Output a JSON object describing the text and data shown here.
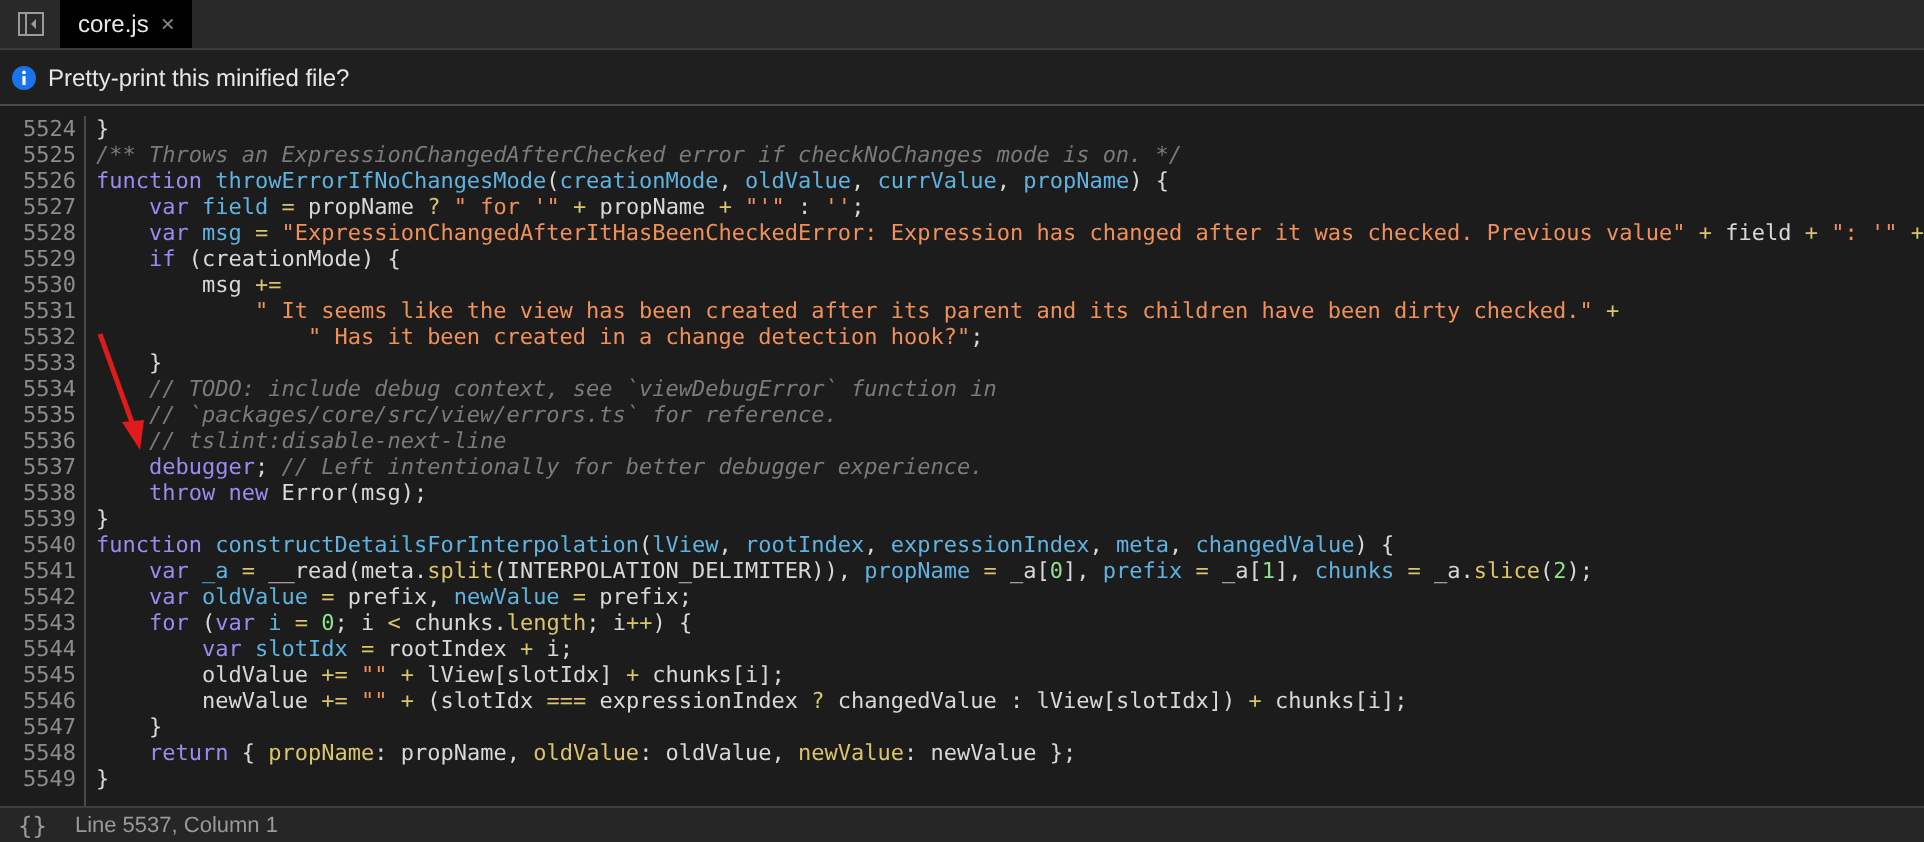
{
  "tab_bar": {
    "tabs": [
      {
        "label": "core.js",
        "close": "×",
        "selected": true
      }
    ]
  },
  "info_bar": {
    "message": "Pretty-print this minified file?"
  },
  "editor": {
    "lines": [
      {
        "number": "5524",
        "tokens": [
          {
            "kind": "plain",
            "text": "}"
          }
        ]
      },
      {
        "number": "5525",
        "tokens": [
          {
            "kind": "comment",
            "text": "/** Throws an ExpressionChangedAfterChecked error if checkNoChanges mode is on. */"
          }
        ]
      },
      {
        "number": "5526",
        "tokens": [
          {
            "kind": "keyword",
            "text": "function"
          },
          {
            "kind": "def",
            "text": " throwErrorIfNoChangesMode"
          },
          {
            "kind": "plain",
            "text": "("
          },
          {
            "kind": "def",
            "text": "creationMode"
          },
          {
            "kind": "plain",
            "text": ", "
          },
          {
            "kind": "def",
            "text": "oldValue"
          },
          {
            "kind": "plain",
            "text": ", "
          },
          {
            "kind": "def",
            "text": "currValue"
          },
          {
            "kind": "plain",
            "text": ", "
          },
          {
            "kind": "def",
            "text": "propName"
          },
          {
            "kind": "plain",
            "text": ") {"
          }
        ]
      },
      {
        "number": "5527",
        "tokens": [
          {
            "kind": "keyword",
            "text": "    var"
          },
          {
            "kind": "def",
            "text": " field"
          },
          {
            "kind": "op",
            "text": " ="
          },
          {
            "kind": "plain",
            "text": " propName "
          },
          {
            "kind": "op",
            "text": "?"
          },
          {
            "kind": "string",
            "text": " \" for '\""
          },
          {
            "kind": "op",
            "text": " +"
          },
          {
            "kind": "plain",
            "text": " propName "
          },
          {
            "kind": "op",
            "text": "+"
          },
          {
            "kind": "string",
            "text": " \"'\""
          },
          {
            "kind": "plain",
            "text": " : "
          },
          {
            "kind": "string",
            "text": "''"
          },
          {
            "kind": "plain",
            "text": ";"
          }
        ]
      },
      {
        "number": "5528",
        "tokens": [
          {
            "kind": "keyword",
            "text": "    var"
          },
          {
            "kind": "def",
            "text": " msg"
          },
          {
            "kind": "op",
            "text": " ="
          },
          {
            "kind": "string",
            "text": " \"ExpressionChangedAfterItHasBeenCheckedError: Expression has changed after it was checked. Previous value\""
          },
          {
            "kind": "op",
            "text": " +"
          },
          {
            "kind": "plain",
            "text": " field "
          },
          {
            "kind": "op",
            "text": "+"
          },
          {
            "kind": "string",
            "text": " \": '\""
          },
          {
            "kind": "op",
            "text": " +"
          }
        ]
      },
      {
        "number": "5529",
        "tokens": [
          {
            "kind": "keyword",
            "text": "    if"
          },
          {
            "kind": "plain",
            "text": " (creationMode) {"
          }
        ]
      },
      {
        "number": "5530",
        "tokens": [
          {
            "kind": "plain",
            "text": "        msg "
          },
          {
            "kind": "op",
            "text": "+="
          }
        ]
      },
      {
        "number": "5531",
        "tokens": [
          {
            "kind": "string",
            "text": "            \" It seems like the view has been created after its parent and its children have been dirty checked.\""
          },
          {
            "kind": "op",
            "text": " +"
          }
        ]
      },
      {
        "number": "5532",
        "tokens": [
          {
            "kind": "string",
            "text": "                \" Has it been created in a change detection hook?\""
          },
          {
            "kind": "plain",
            "text": ";"
          }
        ]
      },
      {
        "number": "5533",
        "tokens": [
          {
            "kind": "plain",
            "text": "    }"
          }
        ]
      },
      {
        "number": "5534",
        "tokens": [
          {
            "kind": "comment",
            "text": "    // TODO: include debug context, see `viewDebugError` function in"
          }
        ]
      },
      {
        "number": "5535",
        "tokens": [
          {
            "kind": "comment",
            "text": "    // `packages/core/src/view/errors.ts` for reference."
          }
        ]
      },
      {
        "number": "5536",
        "tokens": [
          {
            "kind": "comment",
            "text": "    // tslint:disable-next-line"
          }
        ]
      },
      {
        "number": "5537",
        "tokens": [
          {
            "kind": "keyword",
            "text": "    debugger"
          },
          {
            "kind": "plain",
            "text": ";"
          },
          {
            "kind": "comment",
            "text": " // Left intentionally for better debugger experience."
          }
        ]
      },
      {
        "number": "5538",
        "tokens": [
          {
            "kind": "keyword",
            "text": "    throw new"
          },
          {
            "kind": "plain",
            "text": " Error(msg);"
          }
        ]
      },
      {
        "number": "5539",
        "tokens": [
          {
            "kind": "plain",
            "text": "}"
          }
        ]
      },
      {
        "number": "5540",
        "tokens": [
          {
            "kind": "keyword",
            "text": "function"
          },
          {
            "kind": "def",
            "text": " constructDetailsForInterpolation"
          },
          {
            "kind": "plain",
            "text": "("
          },
          {
            "kind": "def",
            "text": "lView"
          },
          {
            "kind": "plain",
            "text": ", "
          },
          {
            "kind": "def",
            "text": "rootIndex"
          },
          {
            "kind": "plain",
            "text": ", "
          },
          {
            "kind": "def",
            "text": "expressionIndex"
          },
          {
            "kind": "plain",
            "text": ", "
          },
          {
            "kind": "def",
            "text": "meta"
          },
          {
            "kind": "plain",
            "text": ", "
          },
          {
            "kind": "def",
            "text": "changedValue"
          },
          {
            "kind": "plain",
            "text": ") {"
          }
        ]
      },
      {
        "number": "5541",
        "tokens": [
          {
            "kind": "keyword",
            "text": "    var"
          },
          {
            "kind": "def",
            "text": " _a"
          },
          {
            "kind": "op",
            "text": " ="
          },
          {
            "kind": "plain",
            "text": " __read(meta."
          },
          {
            "kind": "prop",
            "text": "split"
          },
          {
            "kind": "plain",
            "text": "(INTERPOLATION_DELIMITER)), "
          },
          {
            "kind": "def",
            "text": "propName"
          },
          {
            "kind": "op",
            "text": " ="
          },
          {
            "kind": "plain",
            "text": " _a["
          },
          {
            "kind": "number",
            "text": "0"
          },
          {
            "kind": "plain",
            "text": "], "
          },
          {
            "kind": "def",
            "text": "prefix"
          },
          {
            "kind": "op",
            "text": " ="
          },
          {
            "kind": "plain",
            "text": " _a["
          },
          {
            "kind": "number",
            "text": "1"
          },
          {
            "kind": "plain",
            "text": "], "
          },
          {
            "kind": "def",
            "text": "chunks"
          },
          {
            "kind": "op",
            "text": " ="
          },
          {
            "kind": "plain",
            "text": " _a."
          },
          {
            "kind": "prop",
            "text": "slice"
          },
          {
            "kind": "plain",
            "text": "("
          },
          {
            "kind": "number",
            "text": "2"
          },
          {
            "kind": "plain",
            "text": ");"
          }
        ]
      },
      {
        "number": "5542",
        "tokens": [
          {
            "kind": "keyword",
            "text": "    var"
          },
          {
            "kind": "def",
            "text": " oldValue"
          },
          {
            "kind": "op",
            "text": " ="
          },
          {
            "kind": "plain",
            "text": " prefix, "
          },
          {
            "kind": "def",
            "text": "newValue"
          },
          {
            "kind": "op",
            "text": " ="
          },
          {
            "kind": "plain",
            "text": " prefix;"
          }
        ]
      },
      {
        "number": "5543",
        "tokens": [
          {
            "kind": "keyword",
            "text": "    for"
          },
          {
            "kind": "plain",
            "text": " ("
          },
          {
            "kind": "keyword",
            "text": "var"
          },
          {
            "kind": "def",
            "text": " i"
          },
          {
            "kind": "op",
            "text": " ="
          },
          {
            "kind": "number",
            "text": " 0"
          },
          {
            "kind": "plain",
            "text": "; i "
          },
          {
            "kind": "op",
            "text": "<"
          },
          {
            "kind": "plain",
            "text": " chunks."
          },
          {
            "kind": "prop",
            "text": "length"
          },
          {
            "kind": "plain",
            "text": "; i"
          },
          {
            "kind": "op",
            "text": "++"
          },
          {
            "kind": "plain",
            "text": ") {"
          }
        ]
      },
      {
        "number": "5544",
        "tokens": [
          {
            "kind": "keyword",
            "text": "        var"
          },
          {
            "kind": "def",
            "text": " slotIdx"
          },
          {
            "kind": "op",
            "text": " ="
          },
          {
            "kind": "plain",
            "text": " rootIndex "
          },
          {
            "kind": "op",
            "text": "+"
          },
          {
            "kind": "plain",
            "text": " i;"
          }
        ]
      },
      {
        "number": "5545",
        "tokens": [
          {
            "kind": "plain",
            "text": "        oldValue "
          },
          {
            "kind": "op",
            "text": "+="
          },
          {
            "kind": "string",
            "text": " \"\""
          },
          {
            "kind": "op",
            "text": " +"
          },
          {
            "kind": "plain",
            "text": " lView[slotIdx] "
          },
          {
            "kind": "op",
            "text": "+"
          },
          {
            "kind": "plain",
            "text": " chunks[i];"
          }
        ]
      },
      {
        "number": "5546",
        "tokens": [
          {
            "kind": "plain",
            "text": "        newValue "
          },
          {
            "kind": "op",
            "text": "+="
          },
          {
            "kind": "string",
            "text": " \"\""
          },
          {
            "kind": "op",
            "text": " +"
          },
          {
            "kind": "plain",
            "text": " (slotIdx "
          },
          {
            "kind": "op",
            "text": "==="
          },
          {
            "kind": "plain",
            "text": " expressionIndex "
          },
          {
            "kind": "op",
            "text": "?"
          },
          {
            "kind": "plain",
            "text": " changedValue : lView[slotIdx]) "
          },
          {
            "kind": "op",
            "text": "+"
          },
          {
            "kind": "plain",
            "text": " chunks[i];"
          }
        ]
      },
      {
        "number": "5547",
        "tokens": [
          {
            "kind": "plain",
            "text": "    }"
          }
        ]
      },
      {
        "number": "5548",
        "tokens": [
          {
            "kind": "keyword",
            "text": "    return"
          },
          {
            "kind": "plain",
            "text": " { "
          },
          {
            "kind": "prop",
            "text": "propName"
          },
          {
            "kind": "plain",
            "text": ": propName, "
          },
          {
            "kind": "prop",
            "text": "oldValue"
          },
          {
            "kind": "plain",
            "text": ": oldValue, "
          },
          {
            "kind": "prop",
            "text": "newValue"
          },
          {
            "kind": "plain",
            "text": ": newValue };"
          }
        ]
      },
      {
        "number": "5549",
        "tokens": [
          {
            "kind": "plain",
            "text": "}"
          }
        ]
      }
    ]
  },
  "status_bar": {
    "pretty_print_button": "{}",
    "position": "Line 5537, Column 1"
  }
}
